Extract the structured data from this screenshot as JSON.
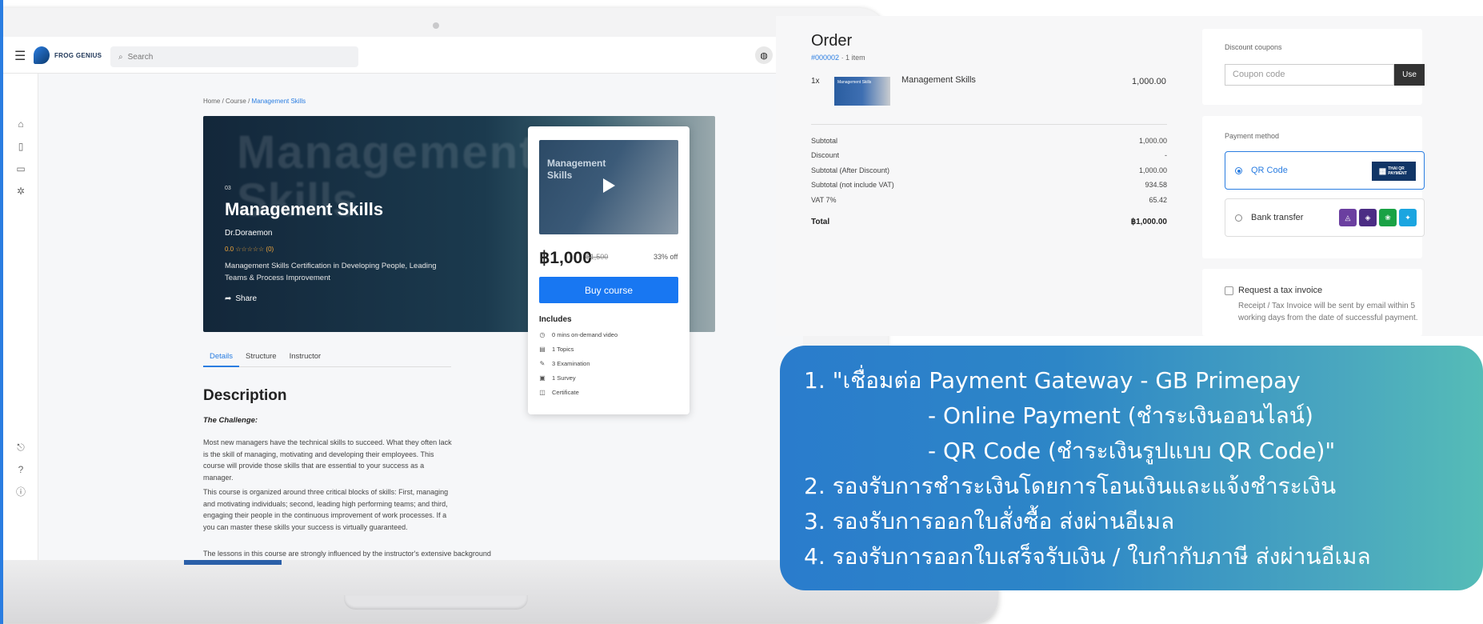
{
  "topbar": {
    "logo_text": "FROG GENIUS",
    "search_placeholder": "Search",
    "search_icon": "search-icon",
    "globe_icon": "globe-icon"
  },
  "sidenav": {
    "top_icons": [
      "home-icon",
      "book-icon",
      "video-icon",
      "bug-icon"
    ],
    "bottom_icons": [
      "logout-icon",
      "help-icon",
      "info-icon"
    ]
  },
  "breadcrumb": {
    "home": "Home",
    "sep1": "/",
    "course": "Course",
    "sep2": "/",
    "current": "Management Skills"
  },
  "hero": {
    "bg_text": "Management",
    "bg_text2": "Skills",
    "number": "03",
    "title": "Management Skills",
    "author": "Dr.Doraemon",
    "rating": "0.0 ☆☆☆☆☆ (0)",
    "description": "Management Skills Certification in Developing People, Leading Teams & Process Improvement",
    "share": "Share"
  },
  "tabs": [
    "Details",
    "Structure",
    "Instructor"
  ],
  "description": {
    "title": "Description",
    "subtitle": "The Challenge:",
    "p1": "Most new managers have the technical skills to succeed. What they often lack is the skill of managing, motivating and developing their employees. This course will provide those skills that are essential to your success as a manager.",
    "p2": "This course is organized around three critical blocks of skills: First, managing and motivating individuals; second, leading high performing teams; and third, engaging their people in the continuous improvement of work processes. If a you can master these skills your success is virtually guaranteed.",
    "p3": "The lessons in this course are strongly influenced by the instructor's extensive background"
  },
  "course_card": {
    "thumb_text": "Management Skills",
    "price": "฿1,000",
    "old_price": "฿1,500",
    "discount": "33% off",
    "buy_label": "Buy course",
    "includes_title": "Includes",
    "includes": [
      {
        "icon": "clock-icon",
        "glyph": "◷",
        "text": "0 mins on-demand video"
      },
      {
        "icon": "document-icon",
        "glyph": "▤",
        "text": "1 Topics"
      },
      {
        "icon": "pencil-icon",
        "glyph": "✎",
        "text": "3 Examination"
      },
      {
        "icon": "survey-icon",
        "glyph": "▣",
        "text": "1 Survey"
      },
      {
        "icon": "certificate-icon",
        "glyph": "◫",
        "text": "Certificate"
      }
    ]
  },
  "order": {
    "title": "Order",
    "order_no": "#000002",
    "item_count": "· 1 item",
    "qty": "1x",
    "thumb_text": "Management Skills",
    "item_name": "Management Skills",
    "item_price": "1,000.00",
    "summary": [
      {
        "label": "Subtotal",
        "value": "1,000.00"
      },
      {
        "label": "Discount",
        "value": "-"
      },
      {
        "label": "Subtotal (After Discount)",
        "value": "1,000.00"
      },
      {
        "label": "Subtotal (not include VAT)",
        "value": "934.58"
      },
      {
        "label": "VAT 7%",
        "value": "65.42"
      }
    ],
    "total_label": "Total",
    "total_value": "฿1,000.00"
  },
  "coupon": {
    "label": "Discount coupons",
    "placeholder": "Coupon code",
    "button": "Use"
  },
  "payment": {
    "label": "Payment method",
    "options": [
      {
        "label": "QR Code",
        "selected": true
      },
      {
        "label": "Bank transfer",
        "selected": false
      }
    ],
    "qr_badge": "THAI QR PAYMENT",
    "banks": [
      {
        "name": "krungsri-logo",
        "color": "#6b3fa0"
      },
      {
        "name": "scb-logo",
        "color": "#4b2d84"
      },
      {
        "name": "kbank-logo",
        "color": "#1aa245"
      },
      {
        "name": "ktb-logo",
        "color": "#1ba5e0"
      }
    ]
  },
  "tax": {
    "label": "Request a tax invoice",
    "note": "Receipt / Tax Invoice will be sent by email within 5 working days from the date of successful payment."
  },
  "banner": {
    "lines": [
      "1. \"เชื่อมต่อ Payment Gateway - GB Primepay",
      "- Online Payment (ชำระเงินออนไลน์)",
      "- QR Code (ชำระเงินรูปแบบ QR Code)\"",
      "2. รองรับการชำระเงินโดยการโอนเงินและแจ้งชำระเงิน",
      "3. รองรับการออกใบสั่งซื้อ ส่งผ่านอีเมล",
      "4. รองรับการออกใบเสร็จรับเงิน / ใบกำกับภาษี  ส่งผ่านอีเมล"
    ]
  }
}
